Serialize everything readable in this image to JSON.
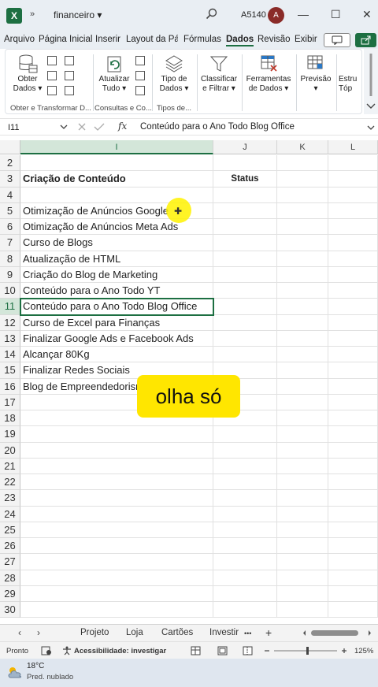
{
  "titlebar": {
    "app_icon_letter": "X",
    "qat_symbol": "»",
    "document_title": "financeiro ▾",
    "search_icon": "search-icon",
    "user_id": "A5140",
    "avatar_letter": "A",
    "minimize": "—",
    "maximize": "☐",
    "close": "✕"
  },
  "tabs": [
    "Arquivo",
    "Página Inicial",
    "Inserir",
    "Layout da Pág",
    "Fórmulas",
    "Dados",
    "Revisão",
    "Exibir"
  ],
  "active_tab": "Dados",
  "ribbon": {
    "obter_dados": "Obter\nDados ▾",
    "group_obter": "Obter e Transformar D...",
    "atualizar": "Atualizar\nTudo ▾",
    "group_consultas": "Consultas e Co...",
    "tipo_dados": "Tipo de\nDados ▾",
    "group_tipos": "Tipos de...",
    "classificar": "Classificar\ne Filtrar ▾",
    "ferramentas": "Ferramentas\nde Dados ▾",
    "previsao": "Previsão\n▾",
    "estrutura": "Estru\nTóp"
  },
  "formula_bar": {
    "name_box": "I11",
    "fx_label": "fx",
    "formula": "Conteúdo para o Ano Todo Blog Office"
  },
  "columns": [
    "I",
    "J",
    "K",
    "L"
  ],
  "selected_column": "I",
  "rows": [
    {
      "n": "2",
      "i": "",
      "j": ""
    },
    {
      "n": "3",
      "i": "Criação de Conteúdo",
      "j": "Status",
      "bold": true
    },
    {
      "n": "4",
      "i": "",
      "j": ""
    },
    {
      "n": "5",
      "i": "Otimização de Anúncios Google",
      "j": ""
    },
    {
      "n": "6",
      "i": "Otimização de Anúncios Meta Ads",
      "j": ""
    },
    {
      "n": "7",
      "i": "Curso de Blogs",
      "j": ""
    },
    {
      "n": "8",
      "i": "Atualização de HTML",
      "j": ""
    },
    {
      "n": "9",
      "i": "Criação do Blog de Marketing",
      "j": ""
    },
    {
      "n": "10",
      "i": "Conteúdo para o Ano Todo YT",
      "j": ""
    },
    {
      "n": "11",
      "i": "Conteúdo para o Ano Todo Blog Office",
      "j": "",
      "active": true
    },
    {
      "n": "12",
      "i": "Curso de Excel para Finanças",
      "j": ""
    },
    {
      "n": "13",
      "i": "Finalizar Google Ads e Facebook Ads",
      "j": ""
    },
    {
      "n": "14",
      "i": "Alcançar 80Kg",
      "j": ""
    },
    {
      "n": "15",
      "i": "Finalizar Redes Sociais",
      "j": ""
    },
    {
      "n": "16",
      "i": "Blog de Empreendedorismo 20 posts",
      "j": ""
    },
    {
      "n": "17",
      "i": "",
      "j": ""
    },
    {
      "n": "18",
      "i": "",
      "j": ""
    },
    {
      "n": "19",
      "i": "",
      "j": ""
    },
    {
      "n": "20",
      "i": "",
      "j": ""
    },
    {
      "n": "21",
      "i": "",
      "j": ""
    },
    {
      "n": "22",
      "i": "",
      "j": ""
    },
    {
      "n": "23",
      "i": "",
      "j": ""
    },
    {
      "n": "24",
      "i": "",
      "j": ""
    },
    {
      "n": "25",
      "i": "",
      "j": ""
    },
    {
      "n": "26",
      "i": "",
      "j": ""
    },
    {
      "n": "27",
      "i": "",
      "j": ""
    },
    {
      "n": "28",
      "i": "",
      "j": ""
    },
    {
      "n": "29",
      "i": "",
      "j": ""
    },
    {
      "n": "30",
      "i": "",
      "j": ""
    }
  ],
  "caption": "olha só",
  "sheets": [
    "Projeto",
    "Loja",
    "Cartões",
    "Investir"
  ],
  "sheet_more": "•••",
  "sheet_add": "+",
  "statusbar": {
    "mode": "Pronto",
    "accessibility": "Acessibilidade: investigar",
    "zoom": "125%"
  },
  "taskbar": {
    "temperature": "18°C",
    "forecast": "Pred. nublado"
  },
  "colors": {
    "excel_green": "#1d6f42",
    "caption_yellow": "#ffe600",
    "avatar_red": "#8a2b28"
  }
}
